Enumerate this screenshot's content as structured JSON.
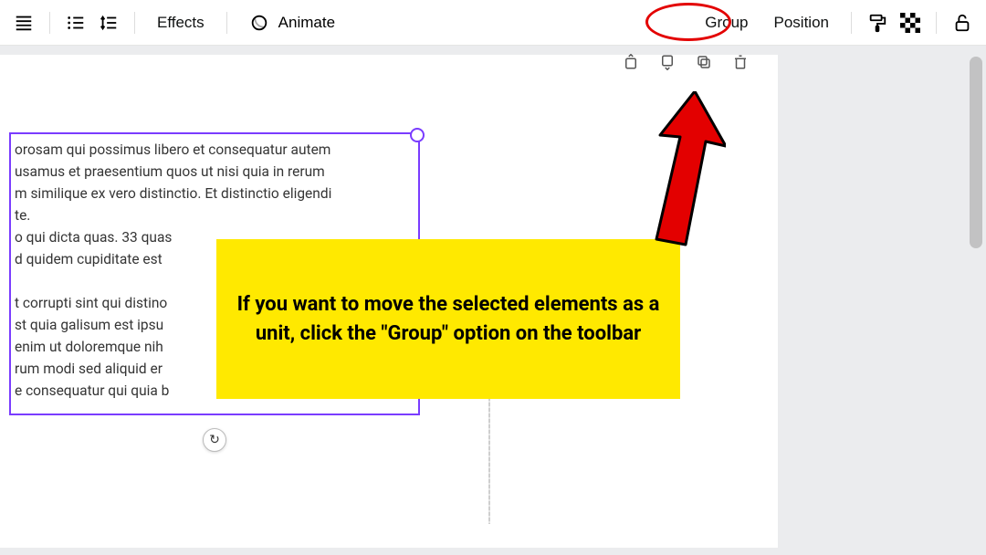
{
  "toolbar": {
    "effects": "Effects",
    "animate": "Animate",
    "group": "Group",
    "position": "Position"
  },
  "canvas": {
    "lorem": "orosam qui possimus libero et consequatur autem\nusamus et praesentium quos ut nisi quia in rerum\nm similique ex vero distinctio. Et distinctio eligendi\nte.\no qui dicta quas. 33 quas\nd quidem cupiditate est\n\nt corrupti sint qui distino\nst quia galisum est ipsu\nenim ut doloremque nih\nrum modi sed aliquid er\ne consequatur qui quia b",
    "rotate_glyph": "↻"
  },
  "annotation": {
    "callout": "If you want to move the selected elements as a unit, click the \"Group\" option on the toolbar"
  }
}
